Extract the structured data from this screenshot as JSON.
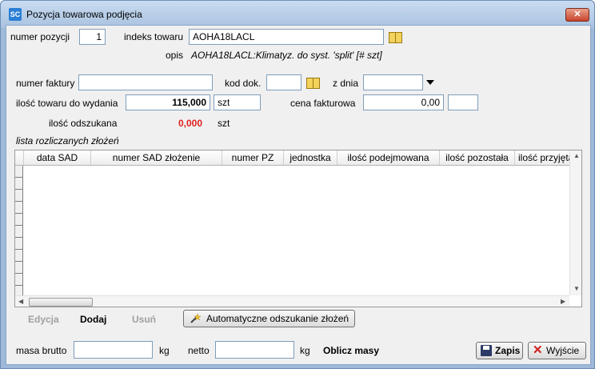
{
  "window": {
    "app_icon": "SC",
    "title": "Pozycja towarowa podjęcia",
    "close_glyph": "✕"
  },
  "form": {
    "numer_pozycji_label": "numer pozycji",
    "numer_pozycji_value": "1",
    "indeks_towaru_label": "indeks towaru",
    "indeks_towaru_value": "AOHA18LACL",
    "opis_label": "opis",
    "opis_value": "AOHA18LACL:Klimatyz. do syst. 'split' [# szt]",
    "numer_faktury_label": "numer faktury",
    "numer_faktury_value": "",
    "kod_dok_label": "kod dok.",
    "kod_dok_value": "",
    "z_dnia_label": "z dnia",
    "z_dnia_value": "",
    "ilosc_do_wydania_label": "ilość towaru do wydania",
    "ilosc_do_wydania_value": "115,000",
    "ilosc_do_wydania_unit": "szt",
    "cena_fakturowa_label": "cena fakturowa",
    "cena_fakturowa_value": "0,00",
    "cena_fakturowa_currency": "",
    "ilosc_odszukana_label": "ilość odszukana",
    "ilosc_odszukana_value": "0,000",
    "ilosc_odszukana_unit": "szt",
    "lista_label": "lista rozliczanych złożeń"
  },
  "colors": {
    "ilosc_odszukana_value": "#e02020"
  },
  "grid": {
    "columns": [
      "data SAD",
      "numer SAD złożenie",
      "numer PZ",
      "jednostka",
      "ilość podejmowana",
      "ilość pozostała",
      "ilość przyjęta"
    ],
    "rows": []
  },
  "actions": {
    "edycja": "Edycja",
    "dodaj": "Dodaj",
    "usun": "Usuń",
    "auto_search": "Automatyczne odszukanie złożeń"
  },
  "footer": {
    "masa_brutto_label": "masa brutto",
    "masa_brutto_value": "",
    "masa_brutto_unit": "kg",
    "netto_label": "netto",
    "netto_value": "",
    "netto_unit": "kg",
    "oblicz_masy": "Oblicz masy",
    "zapis": "Zapis",
    "wyjscie": "Wyjście"
  }
}
